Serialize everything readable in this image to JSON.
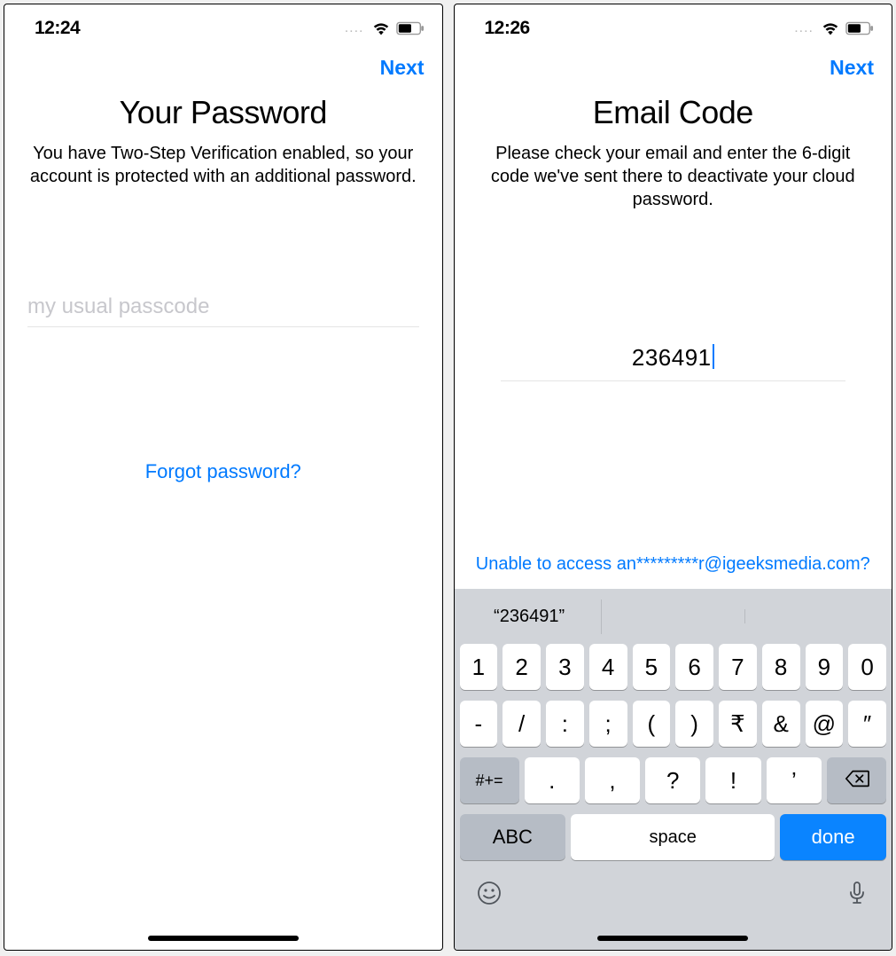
{
  "left": {
    "status_time": "12:24",
    "next_label": "Next",
    "title": "Your Password",
    "subtitle": "You have Two-Step Verification enabled, so your account is protected with an additional password.",
    "placeholder": "my usual passcode",
    "forgot_label": "Forgot password?"
  },
  "right": {
    "status_time": "12:26",
    "next_label": "Next",
    "title": "Email Code",
    "subtitle": "Please check your email and enter the 6-digit code we've sent there to deactivate your cloud password.",
    "code_value": "236491",
    "unable_label": "Unable to access an*********r@igeeksmedia.com?",
    "suggestion": "“236491”",
    "keyboard": {
      "row1": [
        "1",
        "2",
        "3",
        "4",
        "5",
        "6",
        "7",
        "8",
        "9",
        "0"
      ],
      "row2": [
        "-",
        "/",
        ":",
        ";",
        "(",
        ")",
        "₹",
        "&",
        "@",
        "″"
      ],
      "alt_key": "#+=",
      "row3": [
        ".",
        ",",
        "?",
        "!",
        "’"
      ],
      "abc": "ABC",
      "space": "space",
      "done": "done"
    }
  }
}
